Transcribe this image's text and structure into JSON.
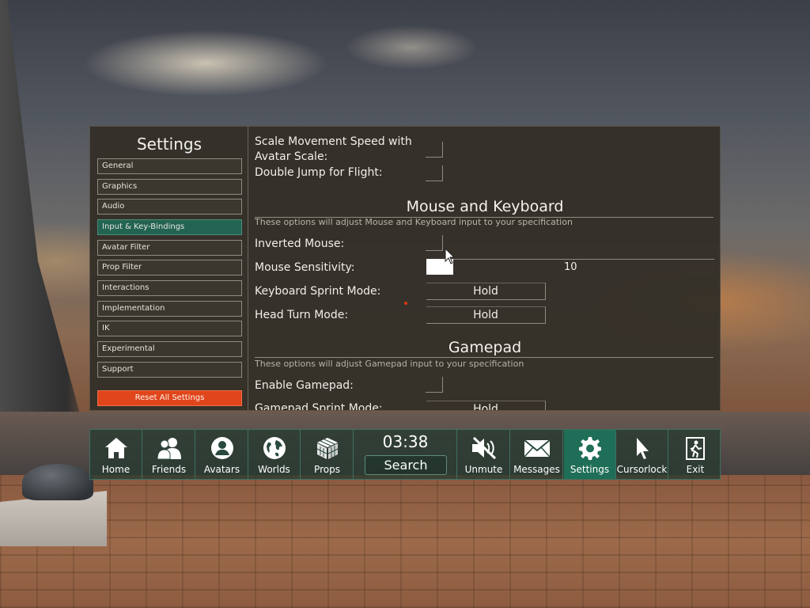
{
  "settings": {
    "title": "Settings",
    "nav_items": [
      {
        "label": "General"
      },
      {
        "label": "Graphics"
      },
      {
        "label": "Audio"
      },
      {
        "label": "Input & Key-Bindings",
        "active": true
      },
      {
        "label": "Avatar Filter"
      },
      {
        "label": "Prop Filter"
      },
      {
        "label": "Interactions"
      },
      {
        "label": "Implementation"
      },
      {
        "label": "IK"
      },
      {
        "label": "Experimental"
      },
      {
        "label": "Support"
      }
    ],
    "reset_label": "Reset All Settings",
    "options": {
      "scale_speed_line1": "Scale Movement Speed with",
      "scale_speed_line2": "Avatar Scale:",
      "double_jump": "Double Jump for Flight:"
    },
    "mouse_keyboard": {
      "title": "Mouse and Keyboard",
      "description": "These options will adjust Mouse and Keyboard input to your specification",
      "inverted_mouse": "Inverted Mouse:",
      "sensitivity_label": "Mouse Sensitivity:",
      "sensitivity_value": "10",
      "sprint_label": "Keyboard Sprint Mode:",
      "sprint_value": "Hold",
      "head_turn_label": "Head Turn Mode:",
      "head_turn_value": "Hold"
    },
    "gamepad": {
      "title": "Gamepad",
      "description": "These options will adjust Gamepad input to your specification",
      "enable_label": "Enable Gamepad:",
      "sprint_label": "Gamepad Sprint Mode:",
      "sprint_value": "Hold"
    }
  },
  "menu": {
    "home": "Home",
    "friends": "Friends",
    "avatars": "Avatars",
    "worlds": "Worlds",
    "props": "Props",
    "clock": "03:38",
    "search": "Search",
    "unmute": "Unmute",
    "messages": "Messages",
    "settings": "Settings",
    "cursorlock": "Cursorlock",
    "exit": "Exit"
  }
}
